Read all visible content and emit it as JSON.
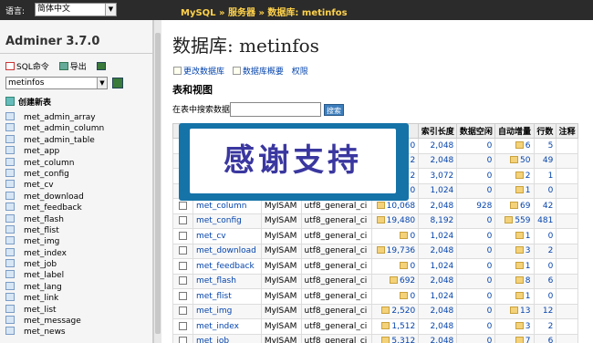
{
  "topbar": {
    "lang_label": "语言:",
    "lang_value": "简体中文",
    "crumbs": [
      "MySQL",
      "服务器",
      "数据库: metinfos"
    ],
    "crumb_sep": " » "
  },
  "sidebar": {
    "title": "Adminer 3.7.0",
    "sql_cmd": "SQL命令",
    "export": "导出",
    "db_value": "metinfos",
    "create_table": "创建新表",
    "tables": [
      "met_admin_array",
      "met_admin_column",
      "met_admin_table",
      "met_app",
      "met_column",
      "met_config",
      "met_cv",
      "met_download",
      "met_feedback",
      "met_flash",
      "met_flist",
      "met_img",
      "met_index",
      "met_job",
      "met_label",
      "met_lang",
      "met_link",
      "met_list",
      "met_message",
      "met_news"
    ]
  },
  "main": {
    "title": "数据库: metinfos",
    "actions": [
      "更改数据库",
      "数据库概要",
      "权限"
    ],
    "section_title": "表和视图",
    "search_label": "在表中搜索数据:",
    "search_button": "搜索",
    "columns": [
      "索引长度",
      "数据空闲",
      "自动增量",
      "行数",
      "注释"
    ],
    "rows": [
      {
        "name": "",
        "engine": "",
        "coll": "",
        "data": "0",
        "index": "2,048",
        "free": "0",
        "ai": "6",
        "rows": "5"
      },
      {
        "name": "",
        "engine": "",
        "coll": "",
        "data": "2",
        "index": "2,048",
        "free": "0",
        "ai": "50",
        "rows": "49"
      },
      {
        "name": "",
        "engine": "",
        "coll": "",
        "data": "2",
        "index": "3,072",
        "free": "0",
        "ai": "2",
        "rows": "1"
      },
      {
        "name": "",
        "engine": "",
        "coll": "",
        "data": "0",
        "index": "1,024",
        "free": "0",
        "ai": "1",
        "rows": "0"
      },
      {
        "name": "met_column",
        "engine": "MyISAM",
        "coll": "utf8_general_ci",
        "data": "10,068",
        "index": "2,048",
        "free": "928",
        "ai": "69",
        "rows": "42"
      },
      {
        "name": "met_config",
        "engine": "MyISAM",
        "coll": "utf8_general_ci",
        "data": "19,480",
        "index": "8,192",
        "free": "0",
        "ai": "559",
        "rows": "481"
      },
      {
        "name": "met_cv",
        "engine": "MyISAM",
        "coll": "utf8_general_ci",
        "data": "0",
        "index": "1,024",
        "free": "0",
        "ai": "1",
        "rows": "0"
      },
      {
        "name": "met_download",
        "engine": "MyISAM",
        "coll": "utf8_general_ci",
        "data": "19,736",
        "index": "2,048",
        "free": "0",
        "ai": "3",
        "rows": "2"
      },
      {
        "name": "met_feedback",
        "engine": "MyISAM",
        "coll": "utf8_general_ci",
        "data": "0",
        "index": "1,024",
        "free": "0",
        "ai": "1",
        "rows": "0"
      },
      {
        "name": "met_flash",
        "engine": "MyISAM",
        "coll": "utf8_general_ci",
        "data": "692",
        "index": "2,048",
        "free": "0",
        "ai": "8",
        "rows": "6"
      },
      {
        "name": "met_flist",
        "engine": "MyISAM",
        "coll": "utf8_general_ci",
        "data": "0",
        "index": "1,024",
        "free": "0",
        "ai": "1",
        "rows": "0"
      },
      {
        "name": "met_img",
        "engine": "MyISAM",
        "coll": "utf8_general_ci",
        "data": "2,520",
        "index": "2,048",
        "free": "0",
        "ai": "13",
        "rows": "12"
      },
      {
        "name": "met_index",
        "engine": "MyISAM",
        "coll": "utf8_general_ci",
        "data": "1,512",
        "index": "2,048",
        "free": "0",
        "ai": "3",
        "rows": "2"
      },
      {
        "name": "met_job",
        "engine": "MyISAM",
        "coll": "utf8_general_ci",
        "data": "5,312",
        "index": "2,048",
        "free": "0",
        "ai": "7",
        "rows": "6"
      }
    ]
  },
  "banner": {
    "text": "感谢支持",
    "bg_color": "#1573a8",
    "text_color": "#3a37a0"
  }
}
